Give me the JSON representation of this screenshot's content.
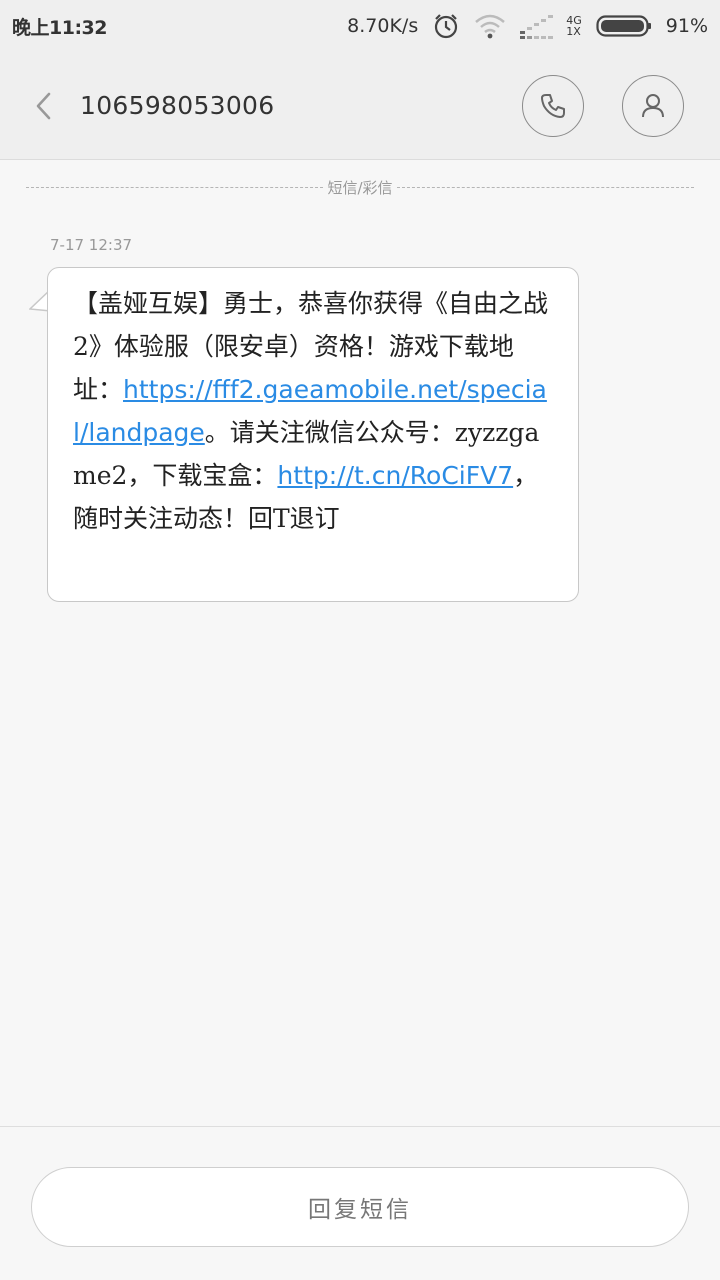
{
  "status_bar": {
    "time": "晚上11:32",
    "net_speed": "8.70K/s",
    "net_type_top": "4G",
    "net_type_bottom": "1X",
    "battery": "91%",
    "icons": [
      "alarm-icon",
      "wifi-icon",
      "signal-icon",
      "battery-icon"
    ]
  },
  "header": {
    "back_icon": "chevron-left-icon",
    "contact": "106598053006",
    "call_icon": "phone-icon",
    "contact_icon": "person-icon"
  },
  "divider": {
    "label": "短信/彩信"
  },
  "message": {
    "timestamp": "7-17 12:37",
    "segments": {
      "t1": "【盖娅互娱】勇士，恭喜你获得《自由之战2》体验服（限安卓）资格！游戏下载地址：",
      "l1": "https://fff2.gaeamobile.net/special/landpage",
      "t2": "。请关注微信公众号：zyzzgame2，下载宝盒：",
      "l2": "http://t.cn/RoCiFV7",
      "t3": "，随时关注动态！回T退订"
    }
  },
  "footer": {
    "reply_label": "回复短信"
  },
  "colors": {
    "link": "#2a8be4",
    "background": "#f7f7f7",
    "header_bg": "#efefef"
  }
}
